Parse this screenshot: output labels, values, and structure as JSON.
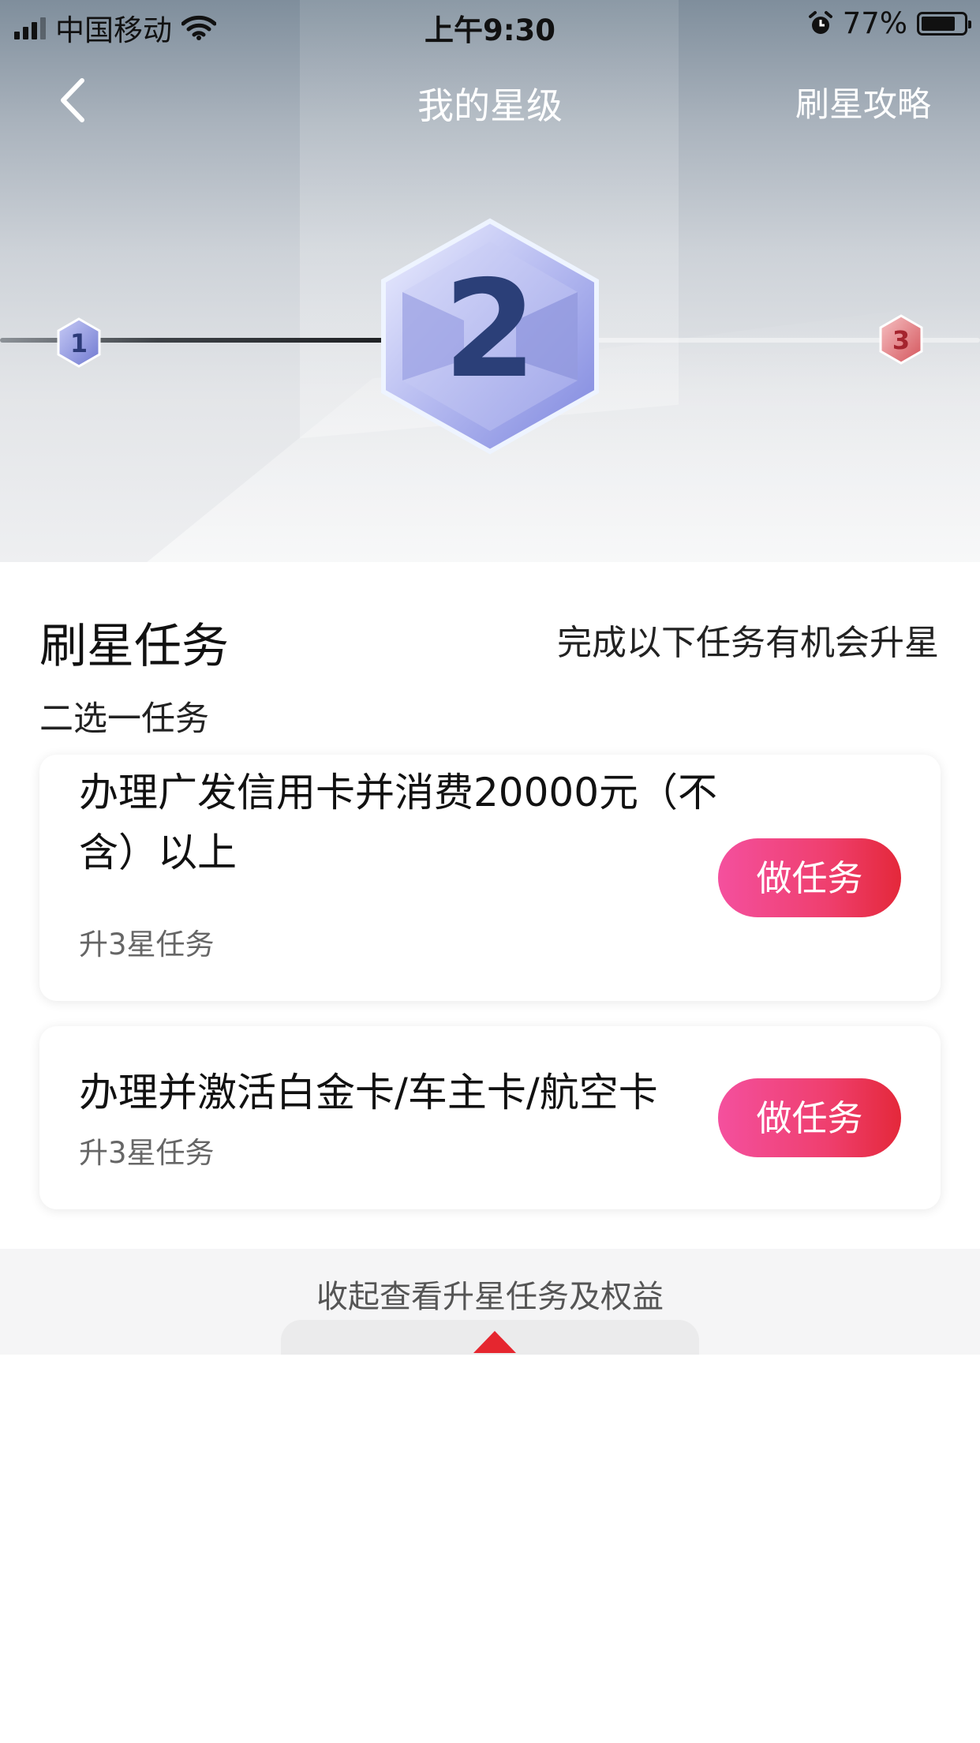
{
  "status_bar": {
    "carrier": "中国移动",
    "time": "上午9:30",
    "battery_percent": "77%",
    "icons": [
      "signal-icon",
      "wifi-icon",
      "alarm-icon",
      "battery-icon"
    ]
  },
  "nav": {
    "title": "我的星级",
    "right_link": "刷星攻略",
    "back_icon": "chevron-left-icon"
  },
  "star_levels": {
    "previous": "1",
    "current": "2",
    "next": "3",
    "colors": {
      "previous": "#7d86d8",
      "current": "#8f96e6",
      "next": "#e06a6f"
    }
  },
  "tasks_section": {
    "title": "刷星任务",
    "hint": "完成以下任务有机会升星",
    "subtitle": "二选一任务",
    "tasks": [
      {
        "title": "办理广发信用卡并消费20000元（不含）以上",
        "tag": "升3星任务",
        "button": "做任务"
      },
      {
        "title": "办理并激活白金卡/车主卡/航空卡",
        "tag": "升3星任务",
        "button": "做任务"
      }
    ]
  },
  "collapse": {
    "label": "收起查看升星任务及权益",
    "icon": "caret-up-icon",
    "accent": "#e5262f"
  }
}
